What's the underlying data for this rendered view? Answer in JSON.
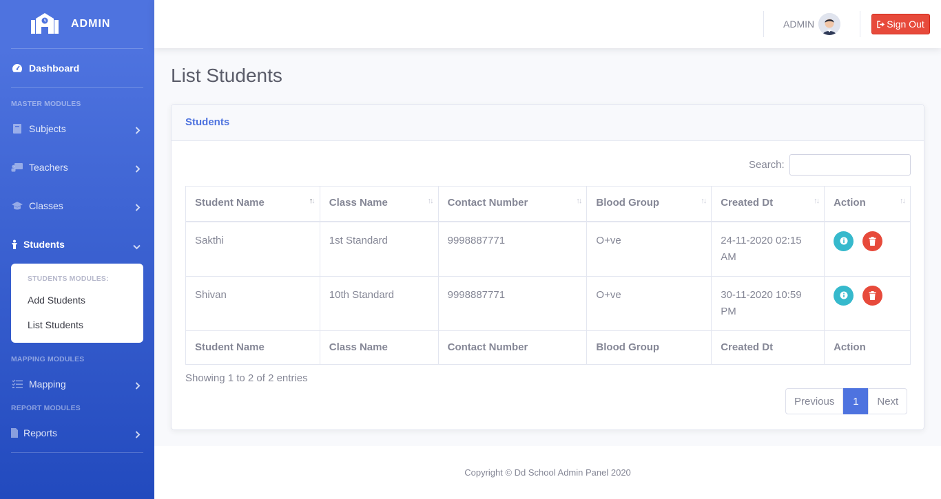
{
  "sidebar": {
    "brand": "ADMIN",
    "dashboard": "Dashboard",
    "master_heading": "MASTER MODULES",
    "subjects": "Subjects",
    "teachers": "Teachers",
    "classes": "Classes",
    "students": "Students",
    "students_submenu": {
      "header": "STUDENTS MODULES:",
      "add": "Add Students",
      "list": "List Students"
    },
    "mapping_heading": "MAPPING MODULES",
    "mapping": "Mapping",
    "report_heading": "REPORT MODULES",
    "reports": "Reports"
  },
  "topbar": {
    "user": "ADMIN",
    "signout": "Sign Out"
  },
  "page_title": "List Students",
  "card": {
    "title": "Students",
    "search_label": "Search:",
    "columns": [
      "Student Name",
      "Class Name",
      "Contact Number",
      "Blood Group",
      "Created Dt",
      "Action"
    ],
    "rows": [
      {
        "name": "Sakthi",
        "class": "1st Standard",
        "contact": "9998887771",
        "blood": "O+ve",
        "created": "24-11-2020 02:15 AM"
      },
      {
        "name": "Shivan",
        "class": "10th Standard",
        "contact": "9998887771",
        "blood": "O+ve",
        "created": "30-11-2020 10:59 PM"
      }
    ],
    "showing": "Showing 1 to 2 of 2 entries",
    "pagination": {
      "previous": "Previous",
      "current": "1",
      "next": "Next"
    }
  },
  "footer": "Copyright © Dd School Admin Panel 2020"
}
